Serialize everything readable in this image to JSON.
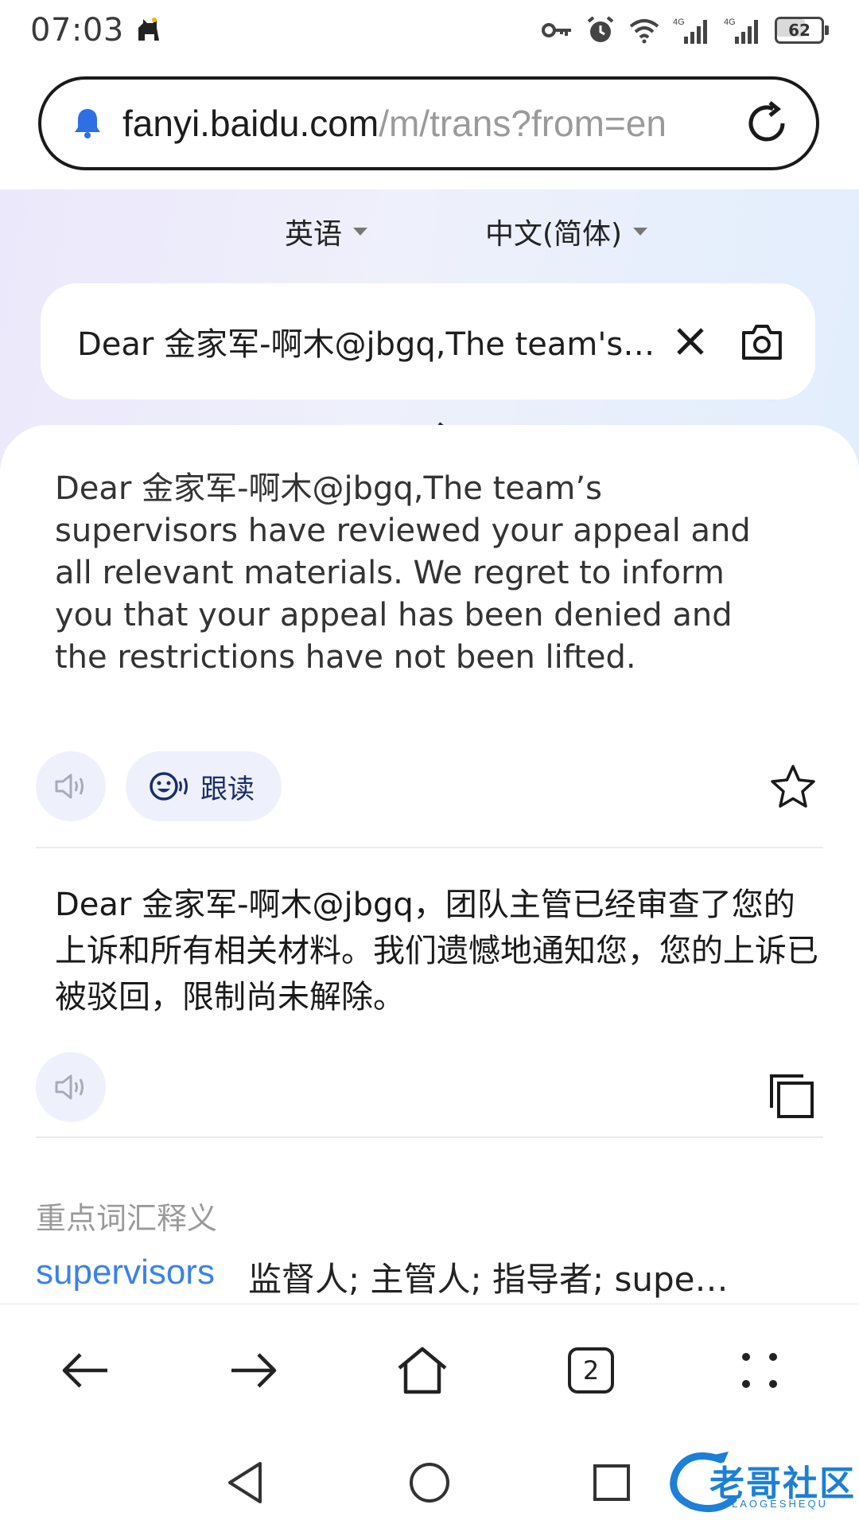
{
  "status_bar": {
    "time": "07:03",
    "battery": "62",
    "battery_level_percent": 62,
    "network_1": "4G",
    "network_2": "4G",
    "icons": [
      "cat-app-icon",
      "key-icon",
      "alarm-icon",
      "wifi-icon",
      "signal-icon",
      "signal-icon",
      "battery-icon"
    ]
  },
  "url_bar": {
    "host": "fanyi.baidu.com",
    "path": "/m/trans?from=en",
    "icons": [
      "bell-icon",
      "reload-icon"
    ]
  },
  "languages": {
    "source": "英语",
    "target": "中文(简体)",
    "icons": [
      "dropdown-caret-icon",
      "swap-icon"
    ]
  },
  "input": {
    "text": "Dear 金家军-啊木@jbgq,The team's supervisors have reviewed your appeal and all relevant materials. We regret to inform you that your appeal has been denied and the restrictions have not been lifted.",
    "icons": [
      "close-icon",
      "camera-icon"
    ]
  },
  "result": {
    "source_text": "Dear 金家军-啊木@jbgq,The team’s supervisors have reviewed your appeal and all relevant materials. We regret to inform you that your appeal has been denied and the restrictions have not been lifted.",
    "follow_read_label": "跟读",
    "translation": "Dear 金家军-啊木@jbgq，团队主管已经审查了您的上诉和所有相关材料。我们遗憾地通知您，您的上诉已被驳回，限制尚未解除。",
    "icons": [
      "speaker-icon",
      "follow-read-icon",
      "star-icon",
      "copy-icon"
    ]
  },
  "vocab": {
    "title": "重点词汇释义",
    "word": "supervisors",
    "definition": "监督人; 主管人; 指导者; supe…"
  },
  "toolbar": {
    "tab_count": "2",
    "icons": [
      "back-arrow-icon",
      "forward-arrow-icon",
      "home-icon",
      "tabs-icon",
      "more-icon"
    ]
  },
  "nav_bar": {
    "icons": [
      "nav-back-icon",
      "nav-home-icon",
      "nav-recents-icon"
    ]
  },
  "watermark": {
    "text": "老哥社区",
    "sub": "LAOGESHEQU"
  },
  "colors": {
    "accent_blue": "#3b82e6",
    "bell_blue": "#2f6fe4",
    "watermark_blue": "#1c7fd8"
  }
}
